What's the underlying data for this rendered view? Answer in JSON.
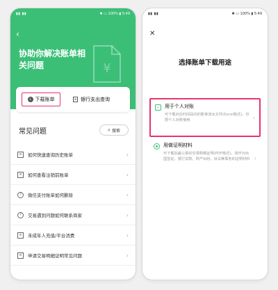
{
  "colors": {
    "accent_green": "#3bbf77",
    "highlight": "#e8336b"
  },
  "left_screen": {
    "status": {
      "left": "▮▮ ▮▮",
      "right": "✱ ▭ 100% ▮ 5:49"
    },
    "back_icon": "chevron-left-icon",
    "hero_title": "协助你解决账单相关问题",
    "hero_icon": "yuan-document-icon",
    "download_label": "下载账单",
    "bank_label": "银行支出查询",
    "faq_title": "常见问题",
    "search_label": "搜索",
    "faq_items": [
      {
        "label": "如何快速查询历史账单",
        "icon": "list-icon"
      },
      {
        "label": "如何查看注销前账单",
        "icon": "list-icon"
      },
      {
        "label": "微信支付账单如何删除",
        "icon": "help-circle-icon"
      },
      {
        "label": "交易遇到问题如何联系商家",
        "icon": "help-circle-icon"
      },
      {
        "label": "未成年人充值/平台消费",
        "icon": "list-icon"
      },
      {
        "label": "申请交易明细证明常见问题",
        "icon": "list-icon"
      }
    ]
  },
  "right_screen": {
    "status": {
      "left": "▮▮ ▮▮",
      "right": "✱ ▭ 100% ▮ 5:49"
    },
    "close_icon": "close-icon",
    "title": "选择账单下载用途",
    "options": [
      {
        "title": "用于个人对账",
        "desc": "可下载对应时间段内的账单流水文件(Excel格式)，仅限个人对账使用"
      },
      {
        "title": "用做证明材料",
        "desc": "可下载加盖公章的交易明细证明(PDF格式)，常作为出国签证、银行贷款、财产纠纷、诉讼等事务的证明材料"
      }
    ]
  }
}
